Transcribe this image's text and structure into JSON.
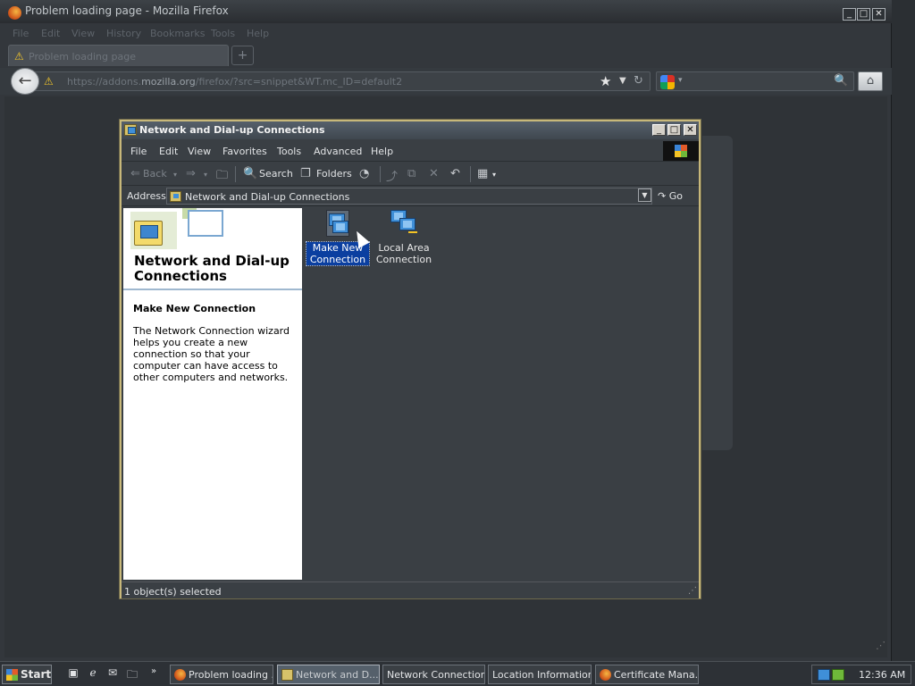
{
  "firefox": {
    "title": "Problem loading page - Mozilla Firefox",
    "menu": [
      "File",
      "Edit",
      "View",
      "History",
      "Bookmarks",
      "Tools",
      "Help"
    ],
    "tab_label": "Problem loading page",
    "new_tab": "+",
    "url_prefix": "https://addons.",
    "url_domain": "mozilla.org",
    "url_suffix": "/firefox/?src=snippet&WT.mc_ID=default2",
    "search_placeholder": ""
  },
  "network_window": {
    "title": "Network and Dial-up Connections",
    "menu": [
      "File",
      "Edit",
      "View",
      "Favorites",
      "Tools",
      "Advanced",
      "Help"
    ],
    "toolbar": {
      "back": "Back",
      "search": "Search",
      "folders": "Folders"
    },
    "address_label": "Address",
    "address_value": "Network and Dial-up Connections",
    "go_label": "Go",
    "left_panel": {
      "heading": "Network and Dial-up Connections",
      "subheading": "Make New Connection",
      "description": "The Network Connection wizard helps you create a new connection so that your computer can have access to other computers and networks."
    },
    "icons": [
      {
        "label": "Make New Connection",
        "selected": true
      },
      {
        "label": "Local Area Connection",
        "selected": false
      }
    ],
    "status": "1 object(s) selected"
  },
  "taskbar": {
    "start": "Start",
    "tasks": [
      {
        "label": "Problem loading ...",
        "active": false
      },
      {
        "label": "Network and D...",
        "active": true
      },
      {
        "label": "Network Connection...",
        "active": false
      },
      {
        "label": "Location Information",
        "active": false
      },
      {
        "label": "Certificate Mana...",
        "active": false
      }
    ],
    "clock": "12:36 AM"
  }
}
